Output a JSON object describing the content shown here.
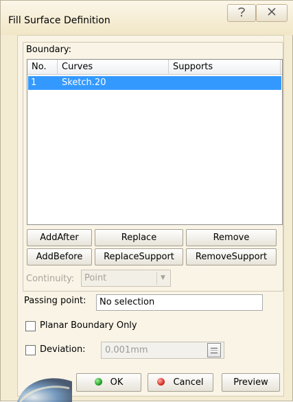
{
  "window": {
    "title": "Fill Surface Definition",
    "help_icon": "question-mark-icon",
    "close_icon": "close-icon"
  },
  "boundary": {
    "label": "Boundary:",
    "columns": [
      "No.",
      "Curves",
      "Supports"
    ],
    "rows": [
      {
        "no": "1",
        "curve": "Sketch.20",
        "support": ""
      }
    ],
    "selected_row_color": "#3399ff"
  },
  "buttons": {
    "add_after": "AddAfter",
    "replace": "Replace",
    "remove": "Remove",
    "add_before": "AddBefore",
    "replace_support": "ReplaceSupport",
    "remove_support": "RemoveSupport"
  },
  "continuity": {
    "label": "Continuity:",
    "value": "Point"
  },
  "passing_point": {
    "label": "Passing point:",
    "value": "No selection"
  },
  "planar_boundary": {
    "label": "Planar Boundary Only",
    "checked": false
  },
  "deviation": {
    "label": "Deviation:",
    "value": "0.001mm",
    "checked": false
  },
  "footer": {
    "ok_label": "OK",
    "cancel_label": "Cancel",
    "preview_label": "Preview",
    "ok_icon": "green-dot-icon",
    "cancel_icon": "red-dot-icon"
  }
}
